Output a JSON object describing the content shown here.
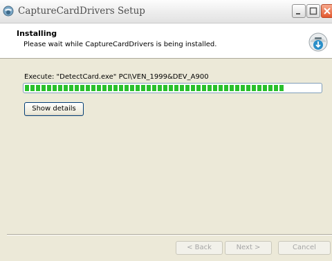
{
  "window": {
    "title": "CaptureCardDrivers Setup",
    "app_icon": "installer-globe-icon"
  },
  "header": {
    "title": "Installing",
    "subtitle": "Please wait while CaptureCardDrivers is being installed.",
    "icon": "setup-disc-icon"
  },
  "progress": {
    "status_text": "Execute: \"DetectCard.exe\" PCI\\VEN_1999&DEV_A900",
    "fraction": 0.88,
    "color": "#29c02c"
  },
  "buttons": {
    "show_details": "Show details",
    "back": "< Back",
    "next": "Next >",
    "cancel": "Cancel"
  }
}
